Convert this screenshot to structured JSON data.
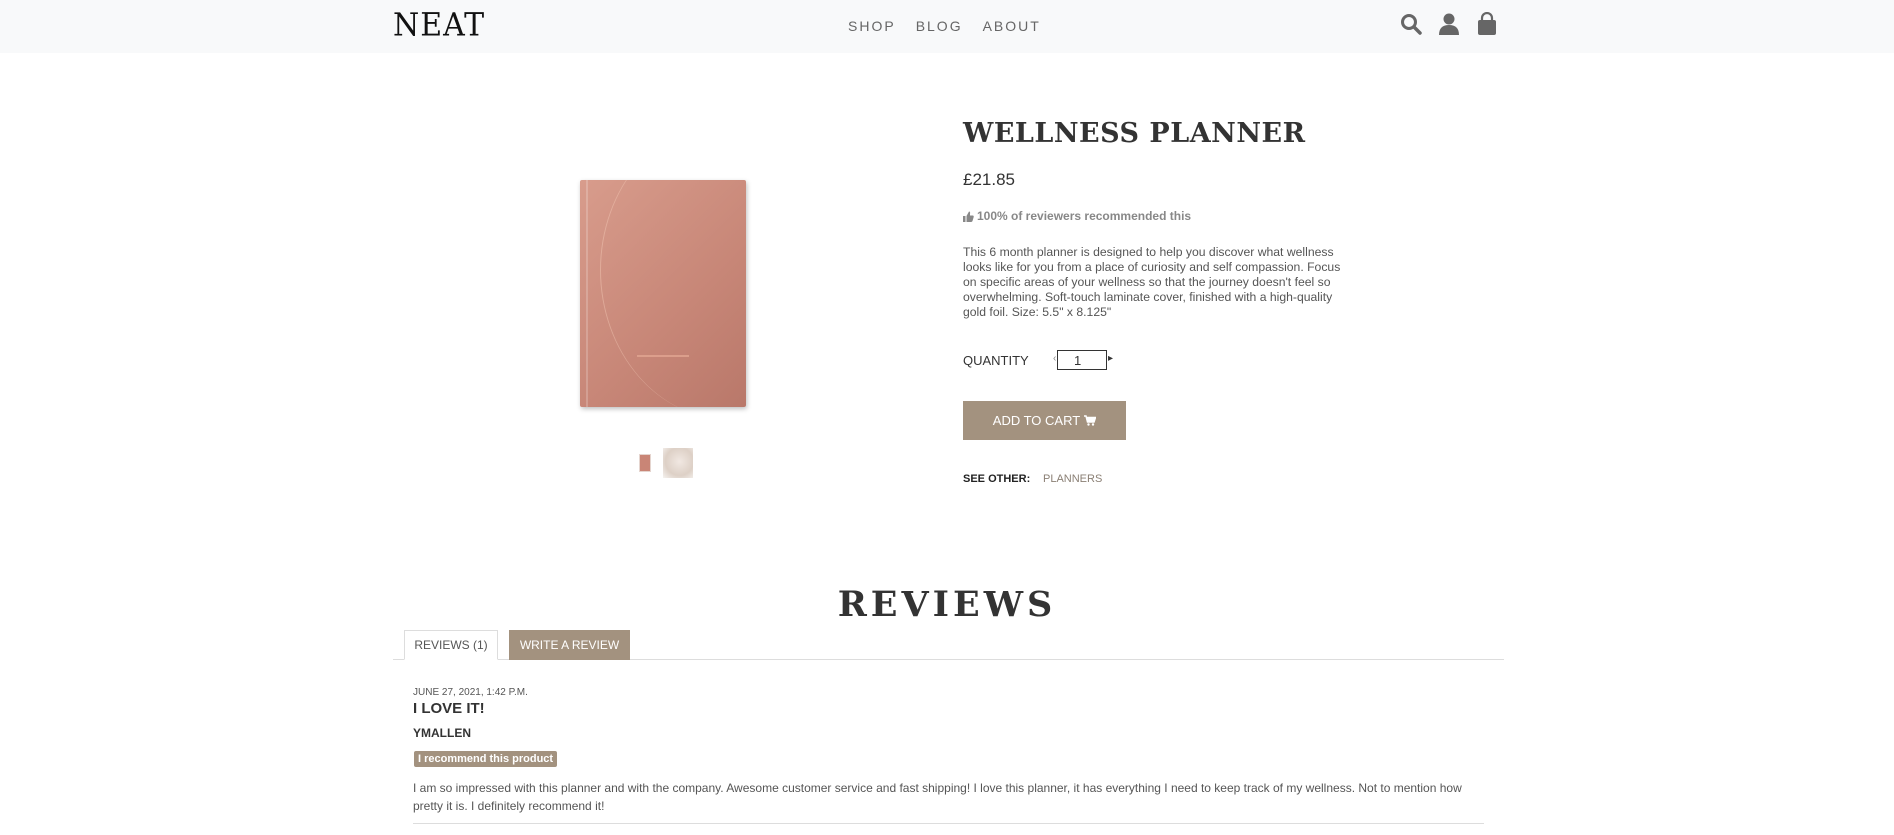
{
  "header": {
    "logo": "NEAT",
    "nav": [
      "SHOP",
      "BLOG",
      "ABOUT"
    ],
    "icons": [
      "search-icon",
      "user-icon",
      "bag-icon"
    ]
  },
  "product": {
    "title": "WELLNESS PLANNER",
    "price": "£21.85",
    "recommend": "100% of reviewers recommended this",
    "description": "This 6 month planner is designed to help you discover what wellness looks like for you from a place of curiosity and self compassion. Focus on specific areas of your wellness so that the journey doesn't feel so overwhelming. Soft-touch laminate cover, finished with a high-quality gold foil. Size: 5.5\" x 8.125\"",
    "quantity_label": "QUANTITY",
    "quantity_value": "1",
    "add_to_cart": "ADD TO CART",
    "see_other_label": "SEE OTHER:",
    "see_other_link": "PLANNERS"
  },
  "reviews": {
    "title": "REVIEWS",
    "tab_reviews": "REVIEWS (1)",
    "tab_write": "WRITE A REVIEW",
    "items": [
      {
        "date": "JUNE 27, 2021, 1:42 P.M.",
        "title": "I LOVE IT!",
        "author": "YMALLEN",
        "badge": "I recommend this product",
        "body": "I am so impressed with this planner and with the company. Awesome customer service and fast shipping! I love this planner, it has everything I need to keep track of my wellness. Not to mention how pretty it is. I definitely recommend it!"
      }
    ]
  },
  "colors": {
    "accent": "#a3927f",
    "header_bg": "#f8f9fa"
  }
}
